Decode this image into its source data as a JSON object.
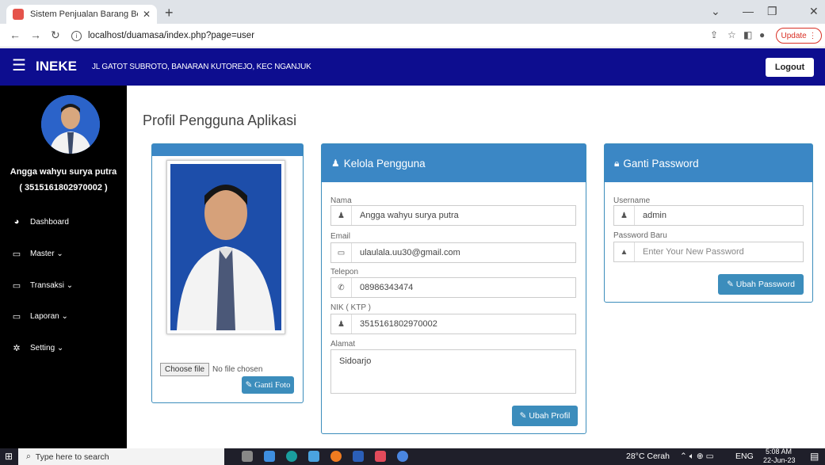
{
  "browser": {
    "tab_title": "Sistem Penjualan Barang Berbasi",
    "url": "localhost/duamasa/index.php?page=user",
    "update_label": "Update"
  },
  "navbar": {
    "brand": "INEKE",
    "address": "JL GATOT SUBROTO, BANARAN KUTOREJO, KEC NGANJUK",
    "logout": "Logout"
  },
  "sidebar": {
    "user_name": "Angga wahyu surya putra",
    "user_nik": "( 3515161802970002 )",
    "items": [
      {
        "label": "Dashboard"
      },
      {
        "label": "Master ⌄"
      },
      {
        "label": "Transaksi ⌄"
      },
      {
        "label": "Laporan ⌄"
      },
      {
        "label": "Setting ⌄"
      }
    ]
  },
  "page": {
    "title": "Profil Pengguna Aplikasi"
  },
  "photo_panel": {
    "choose_file": "Choose file",
    "no_file": "No file chosen",
    "button": "Ganti Foto"
  },
  "kelola": {
    "title": "Kelola Pengguna",
    "nama_label": "Nama",
    "nama": "Angga wahyu surya putra",
    "email_label": "Email",
    "email": "ulaulala.uu30@gmail.com",
    "telepon_label": "Telepon",
    "telepon": "08986343474",
    "nik_label": "NIK ( KTP )",
    "nik": "3515161802970002",
    "alamat_label": "Alamat",
    "alamat": "Sidoarjo",
    "button": "Ubah Profil"
  },
  "password": {
    "title": "Ganti Password",
    "username_label": "Username",
    "username": "admin",
    "new_label": "Password Baru",
    "new_placeholder": "Enter Your New Password",
    "button": "Ubah Password"
  },
  "taskbar": {
    "search": "Type here to search",
    "weather": "28°C Cerah",
    "lang": "ENG",
    "time": "5:08 AM",
    "date": "22-Jun-23"
  }
}
